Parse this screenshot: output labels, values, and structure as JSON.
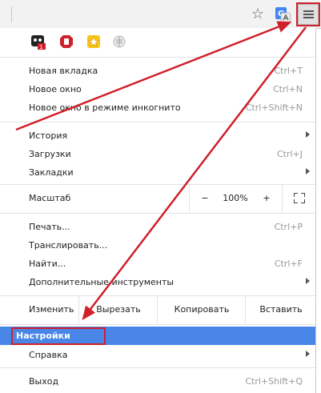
{
  "toolbar": {
    "icons": [
      "star-icon",
      "google-translate-icon",
      "hamburger-menu-icon"
    ],
    "accent_color": "#d0202a"
  },
  "extensions": [
    "ghostery-icon",
    "adblock-icon",
    "extension-star-icon",
    "extension-disabled-icon"
  ],
  "menu": {
    "group1": [
      {
        "label": "Новая вкладка",
        "shortcut": "Ctrl+T"
      },
      {
        "label": "Новое окно",
        "shortcut": "Ctrl+N"
      },
      {
        "label": "Новое окно в режиме инкогнито",
        "shortcut": "Ctrl+Shift+N"
      }
    ],
    "group2": [
      {
        "label": "История",
        "shortcut": ""
      },
      {
        "label": "Загрузки",
        "shortcut": "Ctrl+J"
      },
      {
        "label": "Закладки",
        "shortcut": ""
      }
    ],
    "zoom": {
      "label": "Масштаб",
      "minus": "−",
      "value": "100%",
      "plus": "+"
    },
    "group3": [
      {
        "label": "Печать...",
        "shortcut": "Ctrl+P"
      },
      {
        "label": "Транслировать...",
        "shortcut": ""
      },
      {
        "label": "Найти...",
        "shortcut": "Ctrl+F"
      },
      {
        "label": "Дополнительные инструменты",
        "shortcut": ""
      }
    ],
    "edit": {
      "label": "Изменить",
      "cut": "Вырезать",
      "copy": "Копировать",
      "paste": "Вставить"
    },
    "settings": {
      "label": "Настройки",
      "highlight_color": "#4a86e8"
    },
    "help": {
      "label": "Справка"
    },
    "exit": {
      "label": "Выход",
      "shortcut": "Ctrl+Shift+Q"
    }
  }
}
